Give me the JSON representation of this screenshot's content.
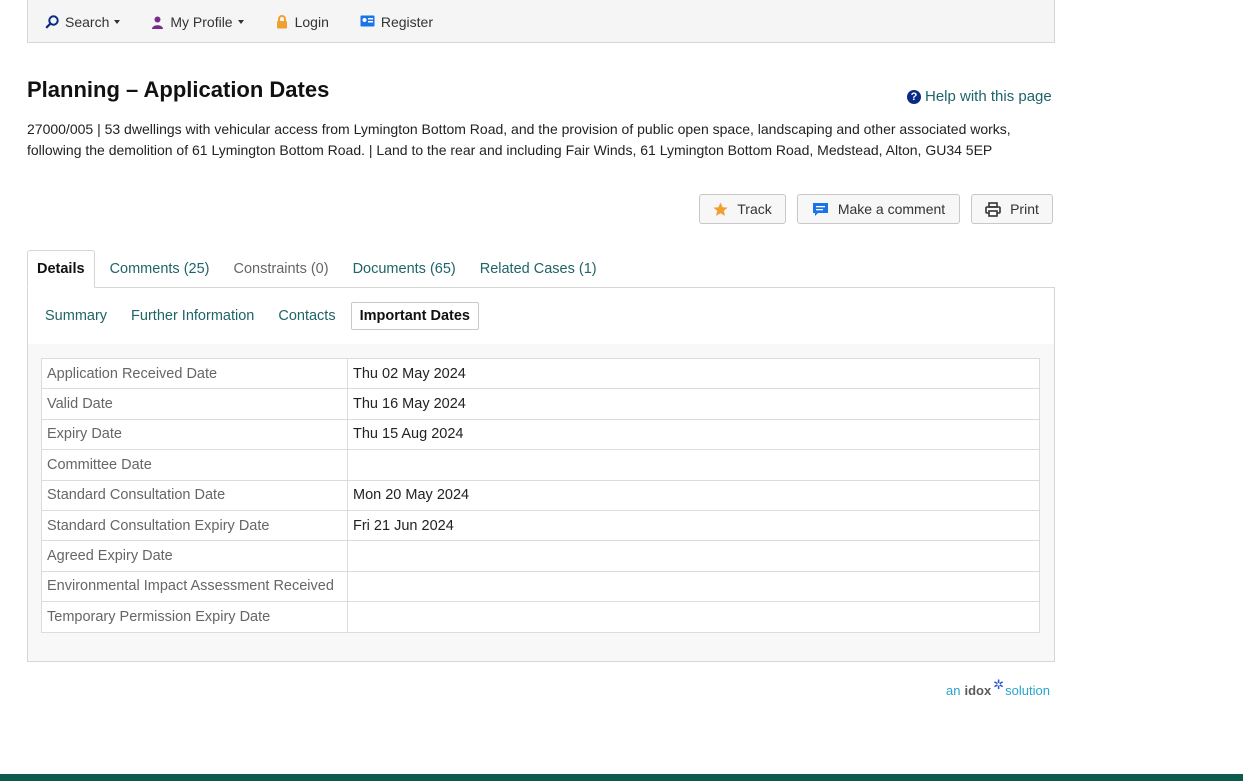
{
  "nav": {
    "search": "Search",
    "profile": "My Profile",
    "login": "Login",
    "register": "Register"
  },
  "heading": {
    "strong": "Planning",
    "rest": " – Application Dates"
  },
  "help_link": "Help with this page",
  "description": "27000/005 | 53 dwellings with vehicular access from Lymington Bottom Road, and the provision of public open space, landscaping and other associated works, following the demolition of 61 Lymington Bottom Road. | Land to the rear and including Fair Winds, 61 Lymington Bottom Road, Medstead, Alton, GU34 5EP",
  "actions": {
    "track": "Track",
    "comment": "Make a comment",
    "print": "Print"
  },
  "tabs": [
    "Details",
    "Comments (25)",
    "Constraints (0)",
    "Documents (65)",
    "Related Cases (1)"
  ],
  "subtabs": [
    "Summary",
    "Further Information",
    "Contacts",
    "Important Dates"
  ],
  "dates": [
    {
      "label": "Application Received Date",
      "value": "Thu 02 May 2024"
    },
    {
      "label": "Valid Date",
      "value": "Thu 16 May 2024"
    },
    {
      "label": "Expiry Date",
      "value": "Thu 15 Aug 2024"
    },
    {
      "label": "Committee Date",
      "value": ""
    },
    {
      "label": "Standard Consultation Date",
      "value": "Mon 20 May 2024"
    },
    {
      "label": "Standard Consultation Expiry Date",
      "value": "Fri 21 Jun 2024"
    },
    {
      "label": "Agreed Expiry Date",
      "value": ""
    },
    {
      "label": "Environmental Impact Assessment Received",
      "value": ""
    },
    {
      "label": "Temporary Permission Expiry Date",
      "value": ""
    }
  ],
  "footer": {
    "prefix": "an",
    "brand": "idox",
    "suffix": "solution"
  },
  "colors": {
    "link": "#1f6469",
    "footer_bar": "#0e5a4c",
    "track_star": "#f0a030",
    "comment_icon": "#1a73e8"
  }
}
